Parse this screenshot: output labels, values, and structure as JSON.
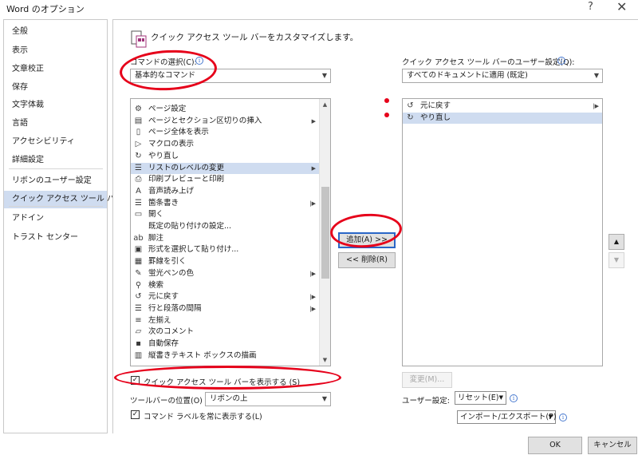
{
  "window": {
    "title": "Word のオプション",
    "help": "?",
    "close": "✕"
  },
  "sidebar": {
    "items": [
      {
        "label": "全般"
      },
      {
        "label": "表示"
      },
      {
        "label": "文章校正"
      },
      {
        "label": "保存"
      },
      {
        "label": "文字体裁"
      },
      {
        "label": "言語"
      },
      {
        "label": "アクセシビリティ"
      },
      {
        "label": "詳細設定"
      },
      {
        "label": "リボンのユーザー設定"
      },
      {
        "label": "クイック アクセス ツール バー",
        "selected": true
      },
      {
        "label": "アドイン"
      },
      {
        "label": "トラスト センター"
      }
    ]
  },
  "header": {
    "title": "クイック アクセス ツール バーをカスタマイズします。"
  },
  "commands": {
    "label": "コマンドの選択(C):",
    "selected": "基本的なコマンド",
    "items": [
      {
        "label": "ページ設定",
        "icon": "page-setup-icon",
        "glyph": "⚙"
      },
      {
        "label": "ページとセクション区切りの挿入",
        "icon": "page-break-icon",
        "glyph": "▤",
        "submenu": true
      },
      {
        "label": "ページ全体を表示",
        "icon": "one-page-icon",
        "glyph": "▯"
      },
      {
        "label": "マクロの表示",
        "icon": "macro-play-icon",
        "glyph": "▷"
      },
      {
        "label": "やり直し",
        "icon": "redo-icon",
        "glyph": "↻"
      },
      {
        "label": "リストのレベルの変更",
        "icon": "list-level-icon",
        "glyph": "☰",
        "submenu": true,
        "selected": true
      },
      {
        "label": "印刷プレビューと印刷",
        "icon": "print-preview-icon",
        "glyph": "⎙"
      },
      {
        "label": "音声読み上げ",
        "icon": "read-aloud-icon",
        "glyph": "A"
      },
      {
        "label": "箇条書き",
        "icon": "bullets-icon",
        "glyph": "☰",
        "submenu_pipe": true
      },
      {
        "label": "開く",
        "icon": "open-folder-icon",
        "glyph": "▭"
      },
      {
        "label": "既定の貼り付けの設定...",
        "icon": "none",
        "glyph": ""
      },
      {
        "label": "脚注",
        "icon": "footnote-icon",
        "glyph": "ab"
      },
      {
        "label": "形式を選択して貼り付け...",
        "icon": "paste-special-icon",
        "glyph": "▣"
      },
      {
        "label": "罫線を引く",
        "icon": "draw-table-icon",
        "glyph": "▦"
      },
      {
        "label": "蛍光ペンの色",
        "icon": "highlighter-icon",
        "glyph": "✎",
        "submenu_pipe": true
      },
      {
        "label": "検索",
        "icon": "search-icon",
        "glyph": "⚲"
      },
      {
        "label": "元に戻す",
        "icon": "undo-icon",
        "glyph": "↺",
        "submenu_pipe": true
      },
      {
        "label": "行と段落の間隔",
        "icon": "line-spacing-icon",
        "glyph": "☰",
        "submenu_pipe": true
      },
      {
        "label": "左揃え",
        "icon": "align-left-icon",
        "glyph": "≡"
      },
      {
        "label": "次のコメント",
        "icon": "next-comment-icon",
        "glyph": "▱"
      },
      {
        "label": "自動保存",
        "icon": "autosave-icon",
        "glyph": "▪"
      },
      {
        "label": "縦書きテキスト ボックスの描画",
        "icon": "vertical-textbox-icon",
        "glyph": "▥"
      }
    ]
  },
  "toolbar_settings": {
    "label": "クイック アクセス ツール バーのユーザー設定(Q):",
    "selected": "すべてのドキュメントに適用 (既定)",
    "items": [
      {
        "label": "元に戻す",
        "icon": "undo-icon",
        "glyph": "↺",
        "submenu_pipe": true
      },
      {
        "label": "やり直し",
        "icon": "redo-icon",
        "glyph": "↻",
        "selected": true
      }
    ]
  },
  "buttons": {
    "add": "追加(A) >>",
    "remove": "<< 削除(R)",
    "modify": "変更(M)...",
    "move_up": "▲",
    "move_down": "▼",
    "ok": "OK",
    "cancel": "キャンセル"
  },
  "options": {
    "show_qat": "クイック アクセス ツール バーを表示する (S)",
    "show_qat_checked": "✓",
    "position_label": "ツールバーの位置(O)",
    "position_value": "リボンの上",
    "always_labels": "コマンド ラベルを常に表示する(L)",
    "always_labels_checked": "✓"
  },
  "customize": {
    "label": "ユーザー設定:",
    "reset": "リセット(E)",
    "import_export": "インポート/エクスポート(P)"
  },
  "annotation_color": "#e6001a",
  "accent_color": "#2a66c7"
}
